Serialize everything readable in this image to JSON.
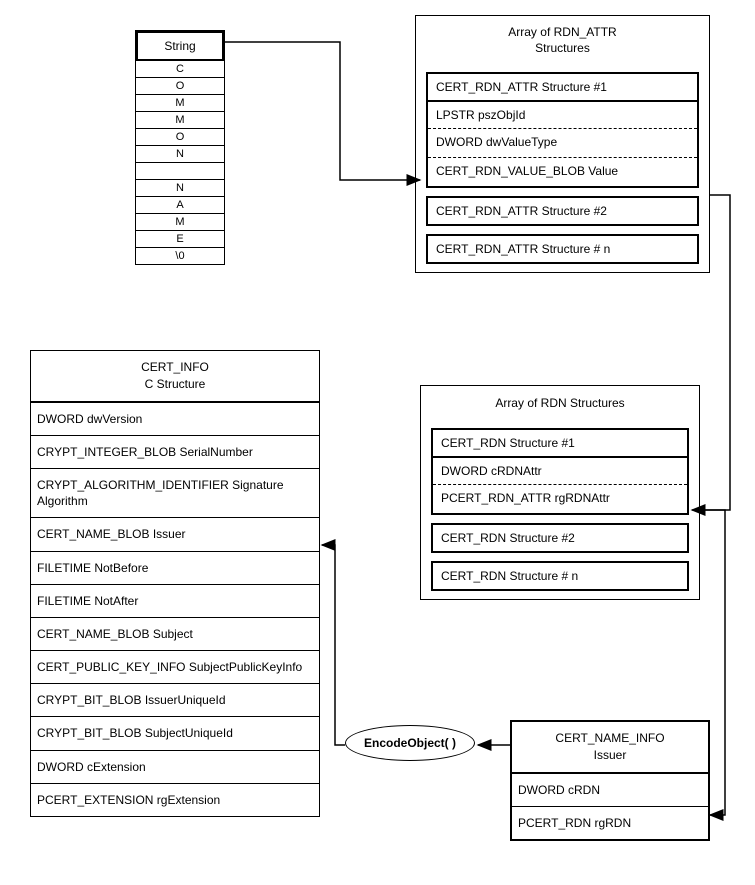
{
  "string_table": {
    "title": "String",
    "chars": [
      "C",
      "O",
      "M",
      "M",
      "O",
      "N",
      " ",
      "N",
      "A",
      "M",
      "E",
      "\\0"
    ]
  },
  "rdn_attr_array": {
    "title": "Array of RDN_ATTR\nStructures",
    "struct1_header": "CERT_RDN_ATTR Structure #1",
    "struct1_field1": "LPSTR pszObjId",
    "struct1_field2": "DWORD dwValueType",
    "struct1_field3": "CERT_RDN_VALUE_BLOB Value",
    "struct2": "CERT_RDN_ATTR Structure #2",
    "structn": "CERT_RDN_ATTR Structure # n"
  },
  "cert_info": {
    "title": "CERT_INFO\nC Structure",
    "rows": [
      "DWORD dwVersion",
      "CRYPT_INTEGER_BLOB SerialNumber",
      "CRYPT_ALGORITHM_IDENTIFIER Signature Algorithm",
      "CERT_NAME_BLOB Issuer",
      "FILETIME NotBefore",
      "FILETIME NotAfter",
      "CERT_NAME_BLOB Subject",
      "CERT_PUBLIC_KEY_INFO SubjectPublicKeyInfo",
      "CRYPT_BIT_BLOB IssuerUniqueId",
      "CRYPT_BIT_BLOB SubjectUniqueId",
      "DWORD cExtension",
      "PCERT_EXTENSION rgExtension"
    ]
  },
  "rdn_array": {
    "title": "Array of RDN  Structures",
    "struct1_header": "CERT_RDN Structure #1",
    "struct1_field1": "DWORD  cRDNAttr",
    "struct1_field2": "PCERT_RDN_ATTR  rgRDNAttr",
    "struct2": "CERT_RDN Structure #2",
    "structn": "CERT_RDN Structure # n"
  },
  "cert_name_info": {
    "title": "CERT_NAME_INFO\nIssuer",
    "field1": "DWORD  cRDN",
    "field2": "PCERT_RDN    rgRDN"
  },
  "encode_label": "EncodeObject( )"
}
